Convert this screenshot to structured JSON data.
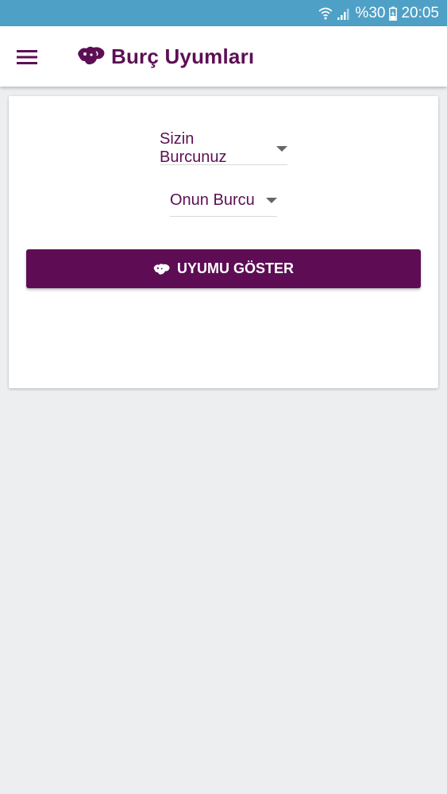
{
  "status_bar": {
    "battery": "%30",
    "time": "20:05",
    "icons": [
      "wifi-icon",
      "signal-icon",
      "battery-charging-icon"
    ]
  },
  "app_bar": {
    "title": "Burç Uyumları",
    "menu_icon": "hamburger-menu-icon",
    "logo_icon": "gemini-zodiac-icon"
  },
  "form": {
    "your_sign": {
      "selected": "Sizin Burcunuz"
    },
    "their_sign": {
      "selected": "Onun Burcu"
    },
    "submit_label": "UYUMU GÖSTER"
  },
  "colors": {
    "status_bar": "#4fa0c6",
    "brand": "#5d0f54",
    "background": "#eceef0"
  }
}
